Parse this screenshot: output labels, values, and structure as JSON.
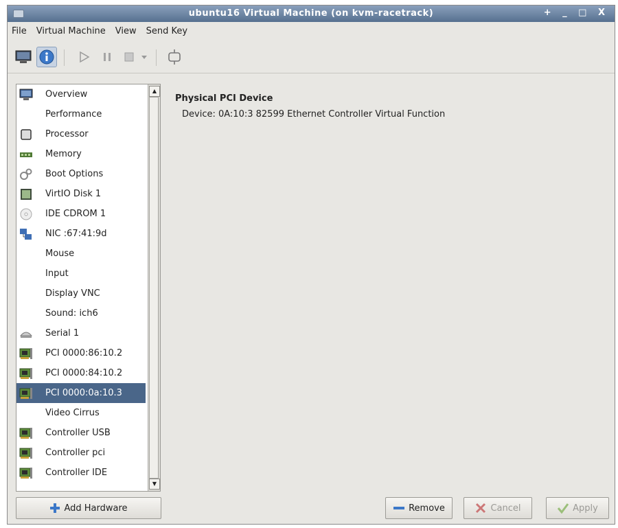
{
  "window": {
    "title": "ubuntu16 Virtual Machine (on kvm-racetrack)",
    "controls": "+ _ □ X"
  },
  "menubar": {
    "items": [
      "File",
      "Virtual Machine",
      "View",
      "Send Key"
    ]
  },
  "toolbar": {
    "buttons": [
      {
        "icon": "monitor-icon",
        "state": "normal"
      },
      {
        "icon": "info-icon",
        "state": "active"
      },
      {
        "icon": "play-icon",
        "state": "disabled"
      },
      {
        "icon": "pause-icon",
        "state": "disabled"
      },
      {
        "icon": "stop-icon",
        "state": "disabled"
      },
      {
        "icon": "chevron-down-icon",
        "state": "disabled"
      },
      {
        "icon": "fullscreen-icon",
        "state": "normal"
      }
    ]
  },
  "sidebar": {
    "items": [
      {
        "label": "Overview",
        "icon": "monitor-icon"
      },
      {
        "label": "Performance",
        "icon": ""
      },
      {
        "label": "Processor",
        "icon": "cpu-icon"
      },
      {
        "label": "Memory",
        "icon": "memory-icon"
      },
      {
        "label": "Boot Options",
        "icon": "gears-icon"
      },
      {
        "label": "VirtIO Disk 1",
        "icon": "disk-icon"
      },
      {
        "label": "IDE CDROM 1",
        "icon": "cdrom-icon"
      },
      {
        "label": "NIC :67:41:9d",
        "icon": "nic-icon"
      },
      {
        "label": "Mouse",
        "icon": ""
      },
      {
        "label": "Input",
        "icon": ""
      },
      {
        "label": "Display VNC",
        "icon": ""
      },
      {
        "label": "Sound: ich6",
        "icon": ""
      },
      {
        "label": "Serial 1",
        "icon": "serial-icon"
      },
      {
        "label": "PCI 0000:86:10.2",
        "icon": "pci-card-icon"
      },
      {
        "label": "PCI 0000:84:10.2",
        "icon": "pci-card-icon"
      },
      {
        "label": "PCI 0000:0a:10.3",
        "icon": "pci-card-icon",
        "selected": true
      },
      {
        "label": "Video Cirrus",
        "icon": ""
      },
      {
        "label": "Controller USB",
        "icon": "pci-card-icon"
      },
      {
        "label": "Controller pci",
        "icon": "pci-card-icon"
      },
      {
        "label": "Controller IDE",
        "icon": "pci-card-icon"
      }
    ]
  },
  "details": {
    "heading": "Physical PCI Device",
    "device_label": "Device:",
    "device_value": "0A:10:3 82599 Ethernet Controller Virtual Function"
  },
  "buttons": {
    "add_hardware": "Add Hardware",
    "remove": "Remove",
    "cancel": "Cancel",
    "apply": "Apply"
  },
  "colors": {
    "titlebar": "#56708f",
    "selection": "#4a6689",
    "pci_card_green": "#5c8a3a",
    "add_icon_blue": "#3c78c8"
  }
}
